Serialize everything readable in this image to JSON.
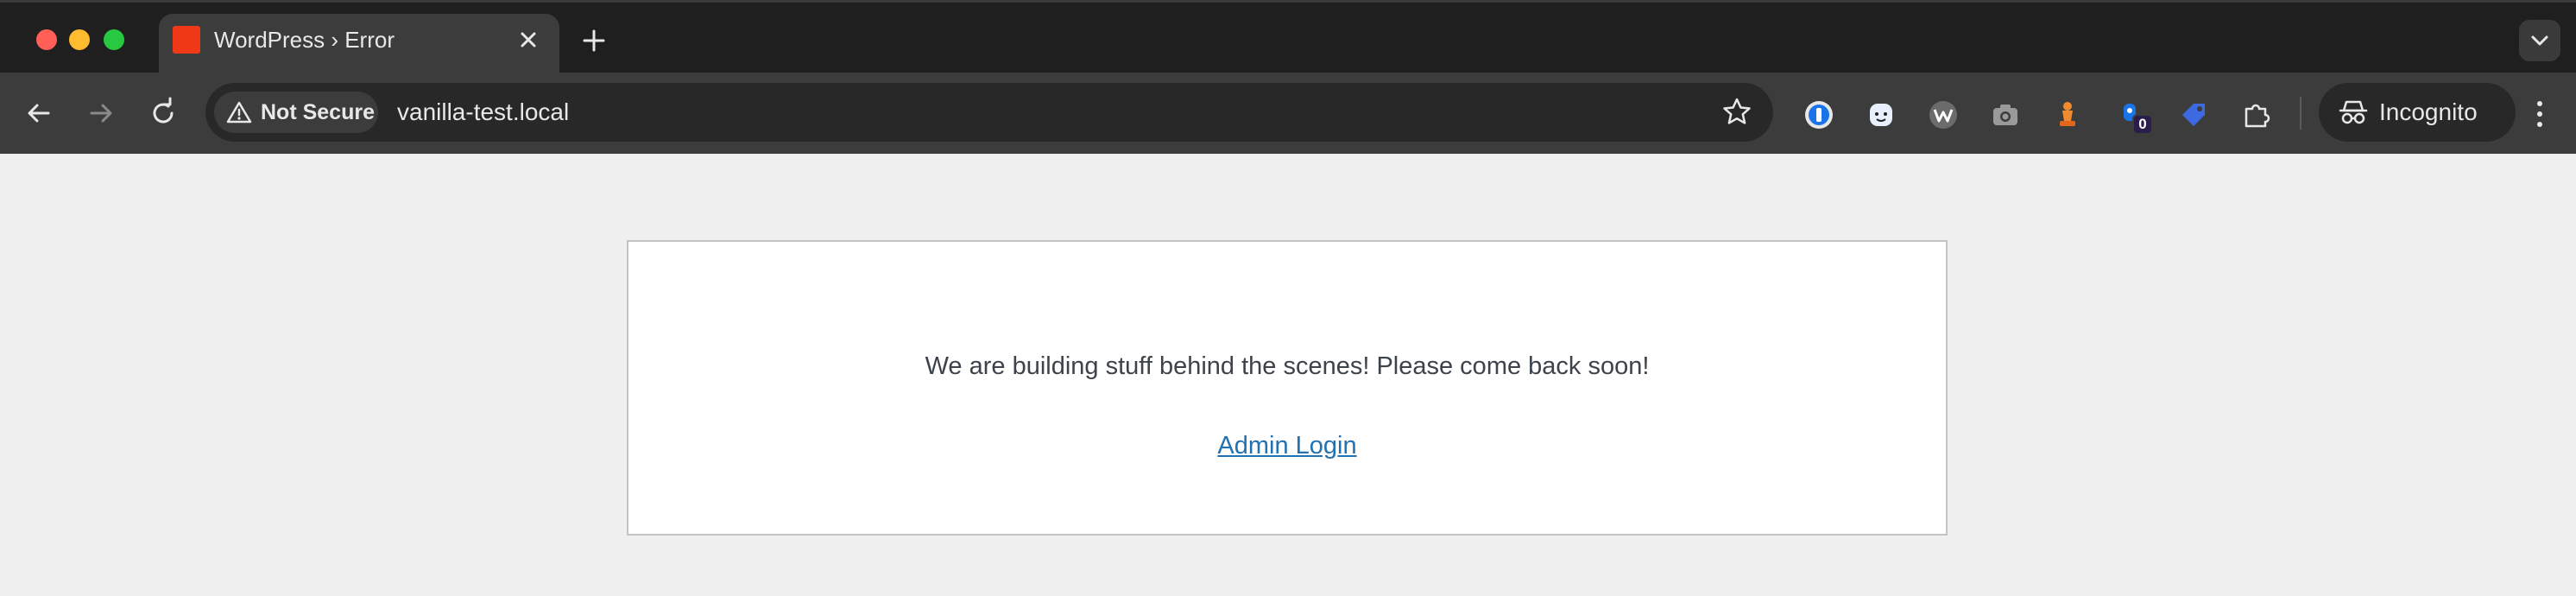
{
  "browser": {
    "tab": {
      "title": "WordPress › Error"
    },
    "omnibox": {
      "security_label": "Not Secure",
      "url": "vanilla-test.local"
    },
    "profile": {
      "label": "Incognito"
    },
    "extensions": [
      {
        "icon": "1password-icon"
      },
      {
        "icon": "ghost-face-icon"
      },
      {
        "icon": "w-logo-icon"
      },
      {
        "icon": "camera-icon"
      },
      {
        "icon": "chess-piece-icon"
      },
      {
        "icon": "hand-badge-icon",
        "badge": "0"
      },
      {
        "icon": "tag-icon"
      },
      {
        "icon": "puzzle-icon"
      }
    ],
    "colors": {
      "favicon": "#f03a17",
      "link": "#2271b1"
    }
  },
  "page": {
    "message": "We are building stuff behind the scenes! Please come back soon!",
    "admin_link": "Admin Login"
  }
}
